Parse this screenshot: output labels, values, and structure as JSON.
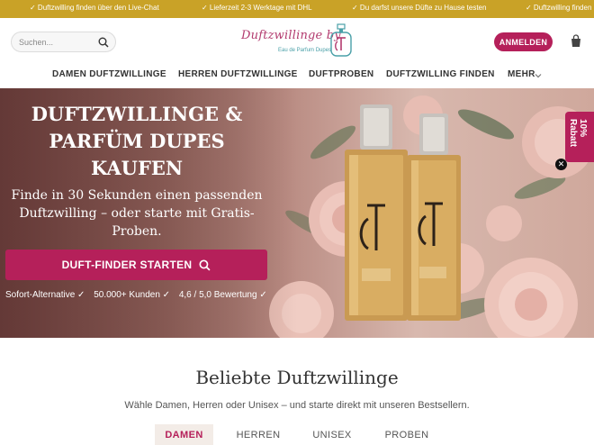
{
  "topbar": {
    "items": [
      "✓ Duftzwilling finden über den Live-Chat",
      "✓ Lieferzeit 2-3 Werktage mit DHL",
      "✓ Du darfst unsere Düfte zu Hause testen",
      "✓ Duftzwilling finden"
    ]
  },
  "header": {
    "search_placeholder": "Suchen...",
    "logo_text": "Duftzwillinge by",
    "logo_sub": "Eau de Parfum Dupes",
    "login_label": "ANMELDEN"
  },
  "nav": {
    "items": [
      "DAMEN DUFTZWILLINGE",
      "HERREN DUFTZWILLINGE",
      "DUFTPROBEN",
      "DUFTZWILLING FINDEN",
      "MEHR"
    ]
  },
  "hero": {
    "title_line1": "DUFTZWILLINGE &",
    "title_line2": "PARFÜM DUPES",
    "title_line3": "KAUFEN",
    "lead_line1": "Finde in 30 Sekunden einen passenden",
    "lead_line2": "Duftzwilling – oder starte mit Gratis-",
    "lead_line3": "Proben.",
    "cta_label": "DUFT-FINDER STARTEN",
    "badges": [
      "Sofort-Alternative ✓",
      "50.000+ Kunden ✓",
      "4,6 / 5,0 Bewertung ✓"
    ],
    "promo_label": "10% Rabatt",
    "promo_close": "✕"
  },
  "section": {
    "title": "Beliebte Duftzwillinge",
    "subtitle": "Wähle Damen, Herren oder Unisex – und starte direkt mit unseren Bestsellern.",
    "tabs": [
      "DAMEN",
      "HERREN",
      "UNISEX",
      "PROBEN"
    ],
    "active_tab": "DAMEN"
  },
  "colors": {
    "accent": "#b5205a",
    "topbar": "#c9a227"
  }
}
